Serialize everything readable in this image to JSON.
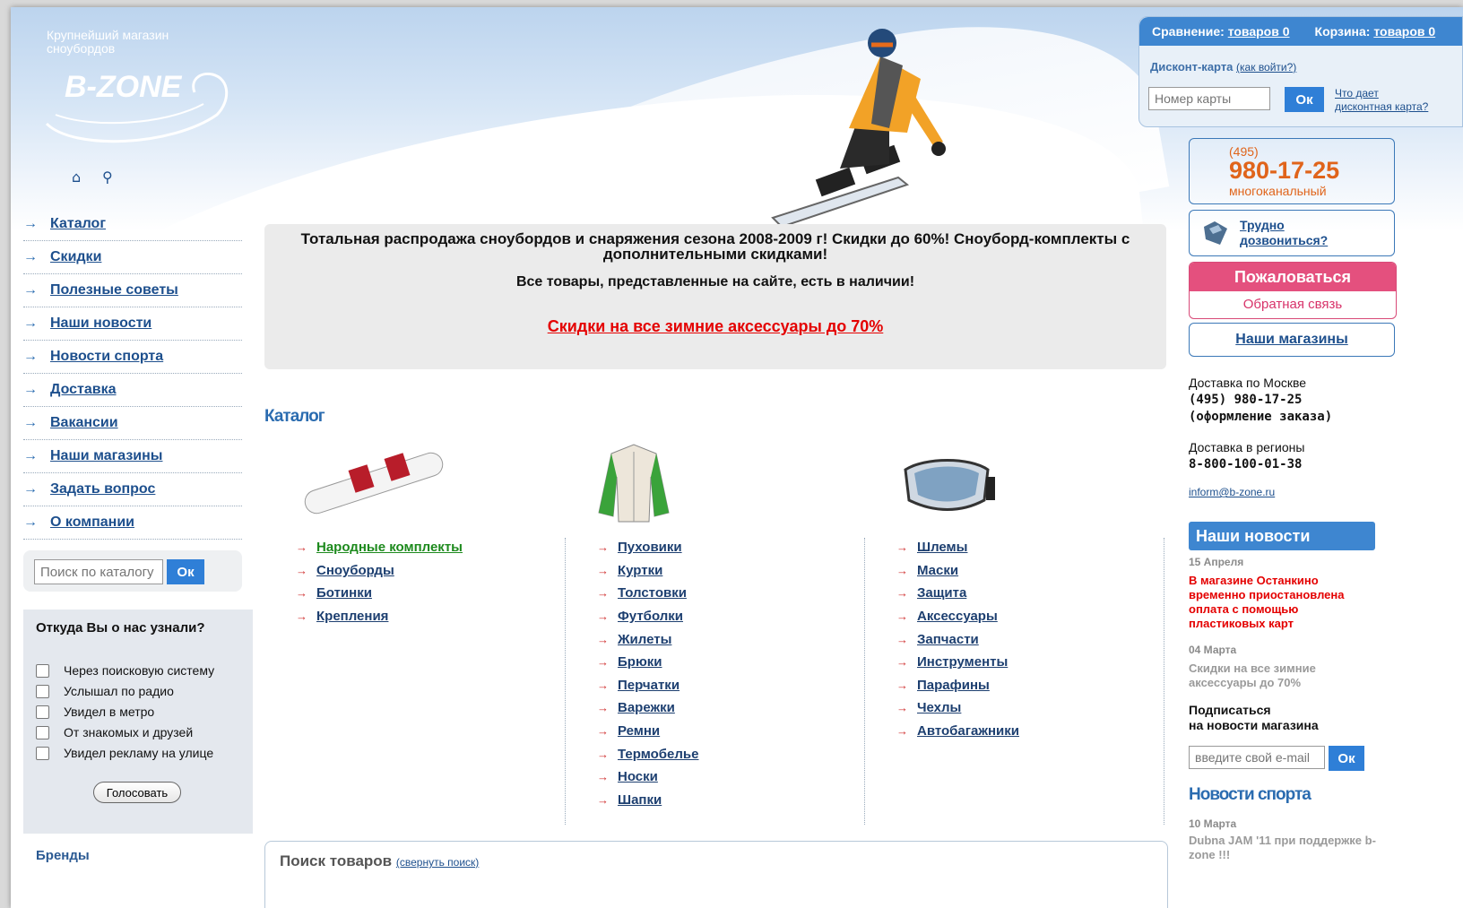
{
  "header": {
    "logo_tagline": "Крупнейший магазин сноубордов",
    "logo_text": "B-ZONE",
    "compare_label": "Сравнение:",
    "compare_link": "товаров 0",
    "cart_label": "Корзина:",
    "cart_link": "товаров 0",
    "discount_label": "Дисконт-карта",
    "discount_how": "(как войти?)",
    "card_placeholder": "Номер карты",
    "card_ok": "Ок",
    "card_what_1": "Что дает",
    "card_what_2": "дисконтная карта?"
  },
  "nav": {
    "items": [
      "Каталог",
      "Скидки",
      "Полезные советы",
      "Наши новости",
      "Новости спорта",
      "Доставка",
      "Вакансии",
      "Наши магазины",
      "Задать вопрос",
      "О компании"
    ]
  },
  "left_search": {
    "placeholder": "Поиск по каталогу",
    "ok": "Ок"
  },
  "poll": {
    "title": "Откуда Вы о нас узнали?",
    "options": [
      "Через поисковую систему",
      "Услышал по радио",
      "Увидел в метро",
      "От знакомых и друзей",
      "Увидел рекламу на улице"
    ],
    "vote": "Голосовать"
  },
  "brands": "Бренды",
  "promo": {
    "line1": "Тотальная распродажа сноубордов и снаряжения сезона 2008-2009 г! Скидки до 60%! Сноуборд-комплекты с дополнительными скидками!",
    "line2": "Все товары, представленные на сайте, есть в наличии!",
    "line3": "Скидки на все зимние аксессуары до 70%"
  },
  "catalog": {
    "title": "Каталог",
    "col1": [
      "Народные комплекты",
      "Сноуборды",
      "Ботинки",
      "Крепления"
    ],
    "col2": [
      "Пуховики",
      "Куртки",
      "Толстовки",
      "Футболки",
      "Жилеты",
      "Брюки",
      "Перчатки",
      "Варежки",
      "Ремни",
      "Термобелье",
      "Носки",
      "Шапки"
    ],
    "col3": [
      "Шлемы",
      "Маски",
      "Защита",
      "Аксессуары",
      "Запчасти",
      "Инструменты",
      "Парафины",
      "Чехлы",
      "Автобагажники"
    ]
  },
  "goods_search": {
    "title": "Поиск товаров",
    "collapse": "(свернуть поиск)"
  },
  "right": {
    "phone_code": "(495)",
    "phone_number": "980-17-25",
    "phone_sub": "многоканальный",
    "hard_1": "Трудно",
    "hard_2": "дозвониться?",
    "complain": "Пожаловаться",
    "feedback": "Обратная связь",
    "stores": "Наши магазины",
    "delivery_moscow": "Доставка по Москве",
    "delivery_moscow_phone": "(495) 980-17-25",
    "delivery_moscow_note": "(оформление заказа)",
    "delivery_regions": "Доставка в регионы",
    "delivery_regions_phone": "8-800-100-01-38",
    "email": "inform@b-zone.ru",
    "news_title": "Наши новости",
    "news1_date": "15 Апреля",
    "news1_text": "В магазине Останкино временно приостановлена оплата с помощью пластиковых карт",
    "news2_date": "04 Марта",
    "news2_text": "Скидки на все зимние аксессуары до 70%",
    "subscribe_1": "Подписаться",
    "subscribe_2": "на новости магазина",
    "email_placeholder": "введите свой e-mail",
    "email_ok": "Ок",
    "sport_title": "Новости спорта",
    "sport1_date": "10 Марта",
    "sport1_text": "Dubna JAM '11 при поддержке b-zone !!!"
  },
  "colors": {
    "accent": "#3e86d0",
    "link": "#1d4f8d",
    "promo_red": "#e40000",
    "phone_orange": "#e0641a",
    "complain_pink": "#e4507e"
  }
}
